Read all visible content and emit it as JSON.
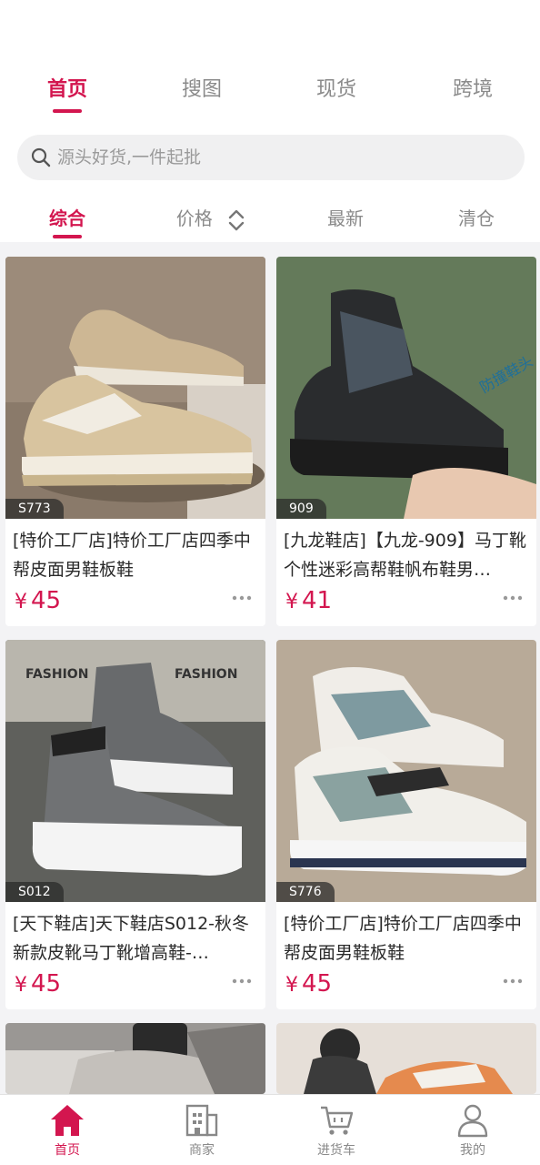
{
  "top_tabs": [
    {
      "label": "首页",
      "active": true
    },
    {
      "label": "搜图",
      "active": false
    },
    {
      "label": "现货",
      "active": false
    },
    {
      "label": "跨境",
      "active": false
    }
  ],
  "search": {
    "placeholder": "源头好货,一件起批",
    "icon": "search-icon"
  },
  "sort_tabs": [
    {
      "label": "综合",
      "active": true
    },
    {
      "label": "价格",
      "active": false,
      "icon": "sort-arrows-icon"
    },
    {
      "label": "最新",
      "active": false
    },
    {
      "label": "清仓",
      "active": false
    }
  ],
  "products": [
    {
      "sku": "S773",
      "title": "[特价工厂店]特价工厂店四季中帮皮面男鞋板鞋",
      "currency": "¥",
      "price": "45"
    },
    {
      "sku": "909",
      "title": "[九龙鞋店]【九龙-909】马丁靴个性迷彩高帮鞋帆布鞋男…",
      "currency": "¥",
      "price": "41",
      "image_text": "防撞鞋头"
    },
    {
      "sku": "S012",
      "title": "[天下鞋店]天下鞋店S012-秋冬新款皮靴马丁靴增高鞋-…",
      "currency": "¥",
      "price": "45",
      "image_text": "FASHION"
    },
    {
      "sku": "S776",
      "title": "[特价工厂店]特价工厂店四季中帮皮面男鞋板鞋",
      "currency": "¥",
      "price": "45"
    },
    {
      "sku": "",
      "title": "",
      "currency": "",
      "price": ""
    },
    {
      "sku": "",
      "title": "",
      "currency": "",
      "price": ""
    }
  ],
  "bottom_nav": [
    {
      "label": "首页",
      "icon": "home-icon",
      "active": true
    },
    {
      "label": "商家",
      "icon": "store-icon",
      "active": false
    },
    {
      "label": "进货车",
      "icon": "cart-icon",
      "active": false
    },
    {
      "label": "我的",
      "icon": "user-icon",
      "active": false
    }
  ],
  "colors": {
    "accent": "#d3164f",
    "inactive": "#8a8a8a",
    "background": "#f3f3f5"
  }
}
